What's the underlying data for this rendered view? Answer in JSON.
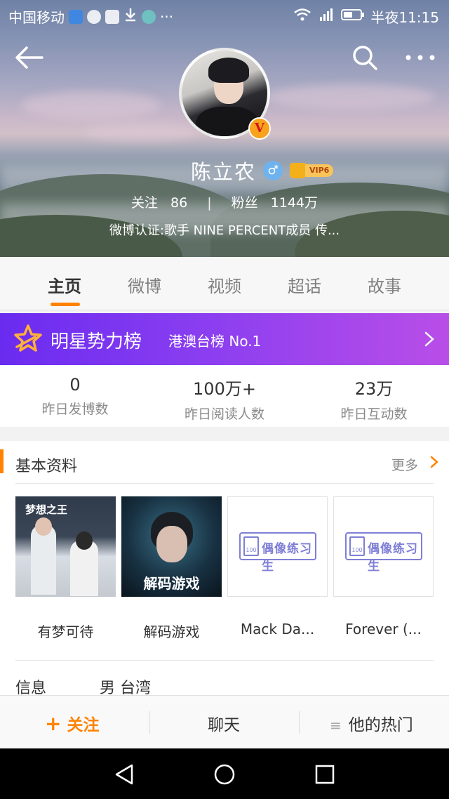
{
  "status_bar": {
    "carrier": "中国移动",
    "overflow": "···",
    "time": "半夜11:15"
  },
  "profile": {
    "name": "陈立农",
    "vip_label": "VIP6",
    "following_label": "关注",
    "following_count": "86",
    "followers_label": "粉丝",
    "followers_count": "1144万",
    "verification": "微博认证:歌手 NINE PERCENT成员 传..."
  },
  "tabs": [
    "主页",
    "微博",
    "视频",
    "超话",
    "故事"
  ],
  "active_tab": "主页",
  "ranking": {
    "title": "明星势力榜",
    "subtitle": "港澳台榜 No.1"
  },
  "metrics": [
    {
      "value": "0",
      "label": "昨日发博数"
    },
    {
      "value": "100万+",
      "label": "昨日阅读人数"
    },
    {
      "value": "23万",
      "label": "昨日互动数"
    }
  ],
  "basic_info": {
    "title": "基本资料",
    "more": "更多",
    "works": [
      {
        "label": "有梦可待"
      },
      {
        "label": "解码游戏"
      },
      {
        "label": "Mack Da..."
      },
      {
        "label": "Forever (..."
      }
    ],
    "poster_text_1": "梦想之王",
    "poster_text_2": "解码游戏",
    "logo_number": "100",
    "logo_text": "偶像练习生",
    "info_label": "信息",
    "info_value": "男 台湾"
  },
  "actions": {
    "follow": "关注",
    "chat": "聊天",
    "hot": "他的热门"
  },
  "colors": {
    "accent": "#ff8200",
    "ranking_start": "#6a2bf0",
    "ranking_end": "#b94ee8"
  }
}
